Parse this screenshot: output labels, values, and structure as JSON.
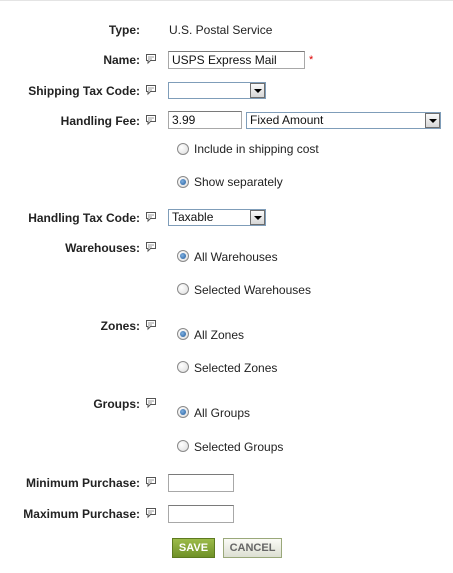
{
  "form": {
    "type_label": "Type:",
    "type_value": "U.S. Postal Service",
    "name_label": "Name:",
    "name_value": "USPS Express Mail",
    "required_mark": "*",
    "shipping_tax_code_label": "Shipping Tax Code:",
    "shipping_tax_code_value": "",
    "handling_fee_label": "Handling Fee:",
    "handling_fee_value": "3.99",
    "handling_fee_type": "Fixed Amount",
    "handling_options": [
      "Include in shipping cost",
      "Show separately"
    ],
    "handling_selected": "Show separately",
    "handling_tax_code_label": "Handling Tax Code:",
    "handling_tax_code_value": "Taxable",
    "warehouses_label": "Warehouses:",
    "warehouse_options": [
      "All Warehouses",
      "Selected Warehouses"
    ],
    "warehouse_selected": "All Warehouses",
    "zones_label": "Zones:",
    "zone_options": [
      "All Zones",
      "Selected Zones"
    ],
    "zone_selected": "All Zones",
    "groups_label": "Groups:",
    "group_options": [
      "All Groups",
      "Selected Groups"
    ],
    "group_selected": "All Groups",
    "min_purchase_label": "Minimum Purchase:",
    "min_purchase_value": "",
    "max_purchase_label": "Maximum Purchase:",
    "max_purchase_value": ""
  },
  "buttons": {
    "save_label": "SAVE",
    "cancel_label": "CANCEL"
  },
  "icons": {
    "help": "help-comment-icon"
  }
}
